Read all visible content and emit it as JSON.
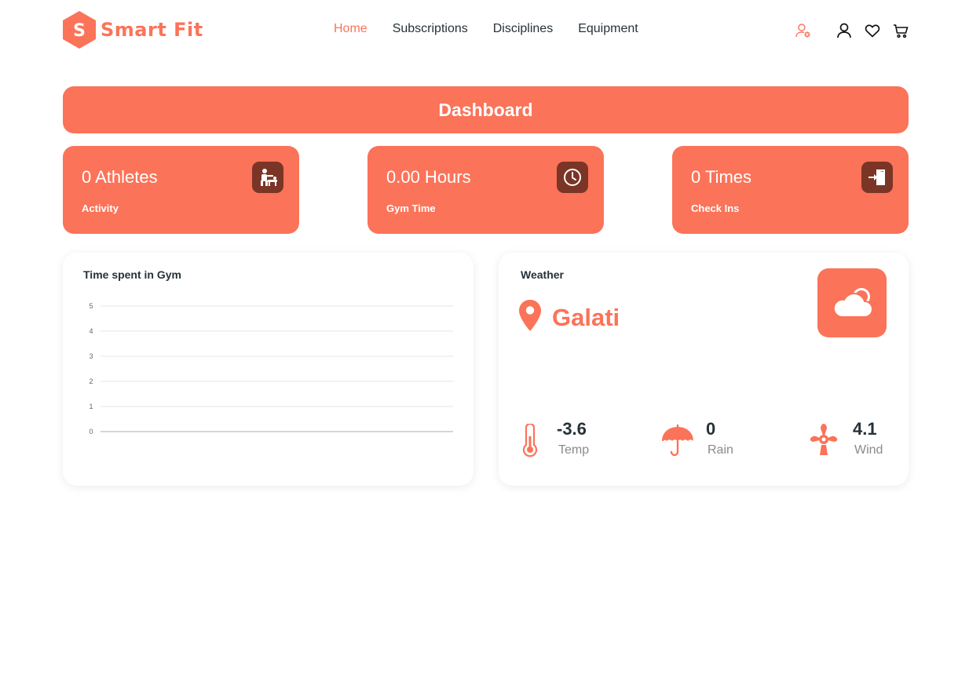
{
  "brand": {
    "name": "Smart Fit",
    "letter": "S",
    "accent_color": "#fb7359",
    "dark_color": "#7b3526"
  },
  "nav": {
    "items": [
      {
        "label": "Home",
        "active": true
      },
      {
        "label": "Subscriptions",
        "active": false
      },
      {
        "label": "Disciplines",
        "active": false
      },
      {
        "label": "Equipment",
        "active": false
      }
    ]
  },
  "header_icons": [
    "user-settings-icon",
    "user-icon",
    "heart-icon",
    "cart-icon"
  ],
  "dashboard": {
    "title": "Dashboard"
  },
  "stats": [
    {
      "value": "0 Athletes",
      "label": "Activity",
      "icon": "trainer-icon"
    },
    {
      "value": "0.00 Hours",
      "label": "Gym Time",
      "icon": "clock-icon"
    },
    {
      "value": "0 Times",
      "label": "Check Ins",
      "icon": "sign-in-icon"
    }
  ],
  "gym_panel": {
    "title": "Time spent in Gym"
  },
  "chart_data": {
    "type": "line",
    "title": "Time spent in Gym",
    "xlabel": "",
    "ylabel": "",
    "x": [],
    "series": [],
    "ylim": [
      0,
      5
    ],
    "yticks": [
      "0",
      "1",
      "2",
      "3",
      "4",
      "5"
    ],
    "grid": true
  },
  "weather": {
    "title": "Weather",
    "location": "Galati",
    "condition_icon": "cloud-icon",
    "metrics": [
      {
        "value": "-3.6",
        "label": "Temp",
        "icon": "thermometer-icon"
      },
      {
        "value": "0",
        "label": "Rain",
        "icon": "umbrella-icon"
      },
      {
        "value": "4.1",
        "label": "Wind",
        "icon": "wind-turbine-icon"
      }
    ]
  }
}
